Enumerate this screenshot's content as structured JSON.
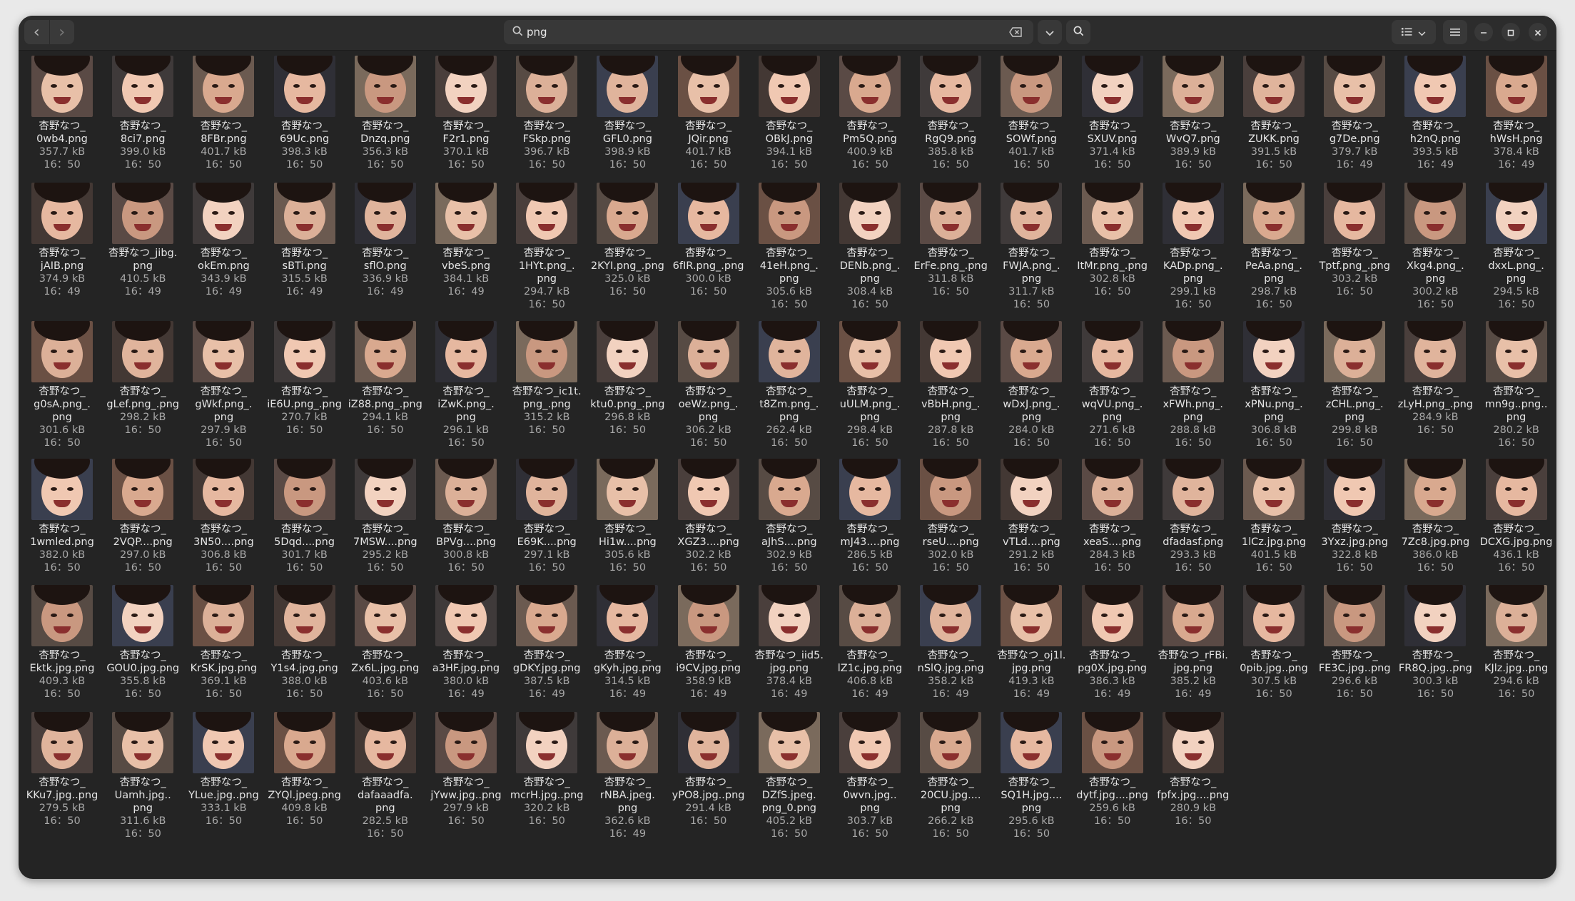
{
  "window": {
    "nav": {
      "back_icon": "chevron-left-icon",
      "forward_icon": "chevron-right-icon"
    },
    "search": {
      "value": "png",
      "placeholder": ""
    },
    "buttons": [
      "search-icon",
      "list-view-icon",
      "dropdown-icon",
      "menu-icon",
      "minimize-icon",
      "maximize-icon",
      "close-icon"
    ]
  },
  "rows": [
    [
      {
        "name": "杏野なつ_\n0wb4.png",
        "size": "357.7 kB",
        "time": "16：50"
      },
      {
        "name": "杏野なつ_\n8ci7.png",
        "size": "399.0 kB",
        "time": "16：50"
      },
      {
        "name": "杏野なつ_\n8FBr.png",
        "size": "401.7 kB",
        "time": "16：50"
      },
      {
        "name": "杏野なつ_\n69Uc.png",
        "size": "398.3 kB",
        "time": "16：50"
      },
      {
        "name": "杏野なつ_\nDnzq.png",
        "size": "356.3 kB",
        "time": "16：50"
      },
      {
        "name": "杏野なつ_\nF2r1.png",
        "size": "370.1 kB",
        "time": "16：50"
      },
      {
        "name": "杏野なつ_\nFSkp.png",
        "size": "396.7 kB",
        "time": "16：50"
      },
      {
        "name": "杏野なつ_\nGFL0.png",
        "size": "398.9 kB",
        "time": "16：50"
      },
      {
        "name": "杏野なつ_\nJQir.png",
        "size": "401.7 kB",
        "time": "16：50"
      },
      {
        "name": "杏野なつ_\nOBkJ.png",
        "size": "394.1 kB",
        "time": "16：50"
      },
      {
        "name": "杏野なつ_\nPm5Q.png",
        "size": "400.9 kB",
        "time": "16：50"
      },
      {
        "name": "杏野なつ_\nRgQ9.png",
        "size": "385.8 kB",
        "time": "16：50"
      },
      {
        "name": "杏野なつ_\nSOWf.png",
        "size": "401.7 kB",
        "time": "16：50"
      },
      {
        "name": "杏野なつ_\nSXUV.png",
        "size": "371.4 kB",
        "time": "16：50"
      },
      {
        "name": "杏野なつ_\nWvQ7.png",
        "size": "389.9 kB",
        "time": "16：50"
      },
      {
        "name": "杏野なつ_\nZUKK.png",
        "size": "391.5 kB",
        "time": "16：50"
      },
      {
        "name": "杏野なつ_\ng7De.png",
        "size": "379.7 kB",
        "time": "16：49"
      },
      {
        "name": "杏野なつ_\nh2nQ.png",
        "size": "393.5 kB",
        "time": "16：49"
      },
      {
        "name": "杏野なつ_\nhWsH.png",
        "size": "378.4 kB",
        "time": "16：49"
      }
    ],
    [
      {
        "name": "杏野なつ_\njAIB.png",
        "size": "374.9 kB",
        "time": "16：49"
      },
      {
        "name": "杏野なつ_jibg.\npng",
        "size": "410.5 kB",
        "time": "16：49"
      },
      {
        "name": "杏野なつ_\nokEm.png",
        "size": "343.9 kB",
        "time": "16：49"
      },
      {
        "name": "杏野なつ_\nsBTi.png",
        "size": "315.5 kB",
        "time": "16：49"
      },
      {
        "name": "杏野なつ_\nsflO.png",
        "size": "336.9 kB",
        "time": "16：49"
      },
      {
        "name": "杏野なつ_\nvbeS.png",
        "size": "384.1 kB",
        "time": "16：49"
      },
      {
        "name": "杏野なつ_\n1HYt.png_.\npng",
        "size": "294.7 kB",
        "time": "16：50"
      },
      {
        "name": "杏野なつ_\n2KYI.png_.png",
        "size": "325.0 kB",
        "time": "16：50"
      },
      {
        "name": "杏野なつ_\n6fIR.png_.png",
        "size": "300.0 kB",
        "time": "16：50"
      },
      {
        "name": "杏野なつ_\n41eH.png_.\npng",
        "size": "305.6 kB",
        "time": "16：50"
      },
      {
        "name": "杏野なつ_\nDENb.png_.\npng",
        "size": "308.4 kB",
        "time": "16：50"
      },
      {
        "name": "杏野なつ_\nErFe.png_.png",
        "size": "311.8 kB",
        "time": "16：50"
      },
      {
        "name": "杏野なつ_\nFWJA.png_.\npng",
        "size": "311.7 kB",
        "time": "16：50"
      },
      {
        "name": "杏野なつ_\nItMr.png_.png",
        "size": "302.8 kB",
        "time": "16：50"
      },
      {
        "name": "杏野なつ_\nKADp.png_.\npng",
        "size": "299.1 kB",
        "time": "16：50"
      },
      {
        "name": "杏野なつ_\nPeAa.png_.\npng",
        "size": "298.7 kB",
        "time": "16：50"
      },
      {
        "name": "杏野なつ_\nTptf.png_.png",
        "size": "303.2 kB",
        "time": "16：50"
      },
      {
        "name": "杏野なつ_\nXkg4.png_.\npng",
        "size": "300.2 kB",
        "time": "16：50"
      },
      {
        "name": "杏野なつ_\ndxxL.png_.\npng",
        "size": "294.5 kB",
        "time": "16：50"
      }
    ],
    [
      {
        "name": "杏野なつ_\ng0sA.png_.\npng",
        "size": "301.6 kB",
        "time": "16：50"
      },
      {
        "name": "杏野なつ_\ngLef.png_.png",
        "size": "298.2 kB",
        "time": "16：50"
      },
      {
        "name": "杏野なつ_\ngWkf.png_.\npng",
        "size": "297.9 kB",
        "time": "16：50"
      },
      {
        "name": "杏野なつ_\niE6U.png_.png",
        "size": "270.7 kB",
        "time": "16：50"
      },
      {
        "name": "杏野なつ_\niZ88.png_.png",
        "size": "294.1 kB",
        "time": "16：50"
      },
      {
        "name": "杏野なつ_\niZwK.png_.\npng",
        "size": "296.1 kB",
        "time": "16：50"
      },
      {
        "name": "杏野なつ_ic1t.\npng_.png",
        "size": "315.2 kB",
        "time": "16：50"
      },
      {
        "name": "杏野なつ_\nktu0.png_.png",
        "size": "296.8 kB",
        "time": "16：50"
      },
      {
        "name": "杏野なつ_\noeWz.png_.\npng",
        "size": "306.2 kB",
        "time": "16：50"
      },
      {
        "name": "杏野なつ_\nt8Zm.png_.\npng",
        "size": "262.4 kB",
        "time": "16：50"
      },
      {
        "name": "杏野なつ_\nuULM.png_.\npng",
        "size": "298.4 kB",
        "time": "16：50"
      },
      {
        "name": "杏野なつ_\nvBbH.png_.\npng",
        "size": "287.8 kB",
        "time": "16：50"
      },
      {
        "name": "杏野なつ_\nwDxJ.png_.\npng",
        "size": "284.0 kB",
        "time": "16：50"
      },
      {
        "name": "杏野なつ_\nwqVU.png_.\npng",
        "size": "271.6 kB",
        "time": "16：50"
      },
      {
        "name": "杏野なつ_\nxFWh.png_.\npng",
        "size": "288.8 kB",
        "time": "16：50"
      },
      {
        "name": "杏野なつ_\nxPNu.png_.\npng",
        "size": "306.8 kB",
        "time": "16：50"
      },
      {
        "name": "杏野なつ_\nzCHL.png_.\npng",
        "size": "299.8 kB",
        "time": "16：50"
      },
      {
        "name": "杏野なつ_\nzLyH.png_.png",
        "size": "284.9 kB",
        "time": "16：50"
      },
      {
        "name": "杏野なつ_\nmn9g..png..\npng",
        "size": "280.2 kB",
        "time": "16：50"
      }
    ],
    [
      {
        "name": "杏野なつ_\n1wmled.png",
        "size": "382.0 kB",
        "time": "16：50"
      },
      {
        "name": "杏野なつ_\n2VQP....png",
        "size": "297.0 kB",
        "time": "16：50"
      },
      {
        "name": "杏野なつ_\n3N50....png",
        "size": "306.8 kB",
        "time": "16：50"
      },
      {
        "name": "杏野なつ_\n5Dqd....png",
        "size": "301.7 kB",
        "time": "16：50"
      },
      {
        "name": "杏野なつ_\n7MSW....png",
        "size": "295.2 kB",
        "time": "16：50"
      },
      {
        "name": "杏野なつ_\nBPVg....png",
        "size": "300.8 kB",
        "time": "16：50"
      },
      {
        "name": "杏野なつ_\nE69K....png",
        "size": "297.1 kB",
        "time": "16：50"
      },
      {
        "name": "杏野なつ_\nHi1w....png",
        "size": "305.6 kB",
        "time": "16：50"
      },
      {
        "name": "杏野なつ_\nXGZ3....png",
        "size": "302.2 kB",
        "time": "16：50"
      },
      {
        "name": "杏野なつ_\naJhS....png",
        "size": "302.9 kB",
        "time": "16：50"
      },
      {
        "name": "杏野なつ_\nmJ43....png",
        "size": "286.5 kB",
        "time": "16：50"
      },
      {
        "name": "杏野なつ_\nrseU....png",
        "size": "302.0 kB",
        "time": "16：50"
      },
      {
        "name": "杏野なつ_\nvTLd....png",
        "size": "291.2 kB",
        "time": "16：50"
      },
      {
        "name": "杏野なつ_\nxeaS....png",
        "size": "284.3 kB",
        "time": "16：50"
      },
      {
        "name": "杏野なつ_\ndfadasf.png",
        "size": "293.3 kB",
        "time": "16：50"
      },
      {
        "name": "杏野なつ_\n1lCz.jpg.png",
        "size": "401.5 kB",
        "time": "16：50"
      },
      {
        "name": "杏野なつ_\n3Yxz.jpg.png",
        "size": "322.8 kB",
        "time": "16：50"
      },
      {
        "name": "杏野なつ_\n7Zc8.jpg.png",
        "size": "386.0 kB",
        "time": "16：50"
      },
      {
        "name": "杏野なつ_\nDCXG.jpg.png",
        "size": "436.1 kB",
        "time": "16：50"
      }
    ],
    [
      {
        "name": "杏野なつ_\nEktk.jpg.png",
        "size": "409.3 kB",
        "time": "16：50"
      },
      {
        "name": "杏野なつ_\nGOU0.jpg.png",
        "size": "355.8 kB",
        "time": "16：50"
      },
      {
        "name": "杏野なつ_\nKrSK.jpg.png",
        "size": "369.1 kB",
        "time": "16：50"
      },
      {
        "name": "杏野なつ_\nY1s4.jpg.png",
        "size": "388.0 kB",
        "time": "16：50"
      },
      {
        "name": "杏野なつ_\nZx6L.jpg.png",
        "size": "403.6 kB",
        "time": "16：50"
      },
      {
        "name": "杏野なつ_\na3HF.jpg.png",
        "size": "380.0 kB",
        "time": "16：49"
      },
      {
        "name": "杏野なつ_\ngDKY.jpg.png",
        "size": "387.5 kB",
        "time": "16：49"
      },
      {
        "name": "杏野なつ_\ngKyh.jpg.png",
        "size": "314.5 kB",
        "time": "16：49"
      },
      {
        "name": "杏野なつ_\ni9CV.jpg.png",
        "size": "358.9 kB",
        "time": "16：49"
      },
      {
        "name": "杏野なつ_iid5.\njpg.png",
        "size": "378.4 kB",
        "time": "16：49"
      },
      {
        "name": "杏野なつ_\nlZ1c.jpg.png",
        "size": "406.8 kB",
        "time": "16：49"
      },
      {
        "name": "杏野なつ_\nnSlQ.jpg.png",
        "size": "358.2 kB",
        "time": "16：49"
      },
      {
        "name": "杏野なつ_oj1l.\njpg.png",
        "size": "419.3 kB",
        "time": "16：49"
      },
      {
        "name": "杏野なつ_\npg0X.jpg.png",
        "size": "386.3 kB",
        "time": "16：49"
      },
      {
        "name": "杏野なつ_rFBi.\njpg.png",
        "size": "385.2 kB",
        "time": "16：49"
      },
      {
        "name": "杏野なつ_\n0pib.jpg..png",
        "size": "307.5 kB",
        "time": "16：50"
      },
      {
        "name": "杏野なつ_\nFE3C.jpg..png",
        "size": "296.6 kB",
        "time": "16：50"
      },
      {
        "name": "杏野なつ_\nFR8Q.jpg..png",
        "size": "300.3 kB",
        "time": "16：50"
      },
      {
        "name": "杏野なつ_\nKJlz.jpg..png",
        "size": "294.6 kB",
        "time": "16：50"
      }
    ],
    [
      {
        "name": "杏野なつ_\nKKu7.jpg..png",
        "size": "279.5 kB",
        "time": "16：50"
      },
      {
        "name": "杏野なつ_\nUamh.jpg..\npng",
        "size": "311.6 kB",
        "time": "16：50"
      },
      {
        "name": "杏野なつ_\nYLue.jpg..png",
        "size": "333.1 kB",
        "time": "16：50"
      },
      {
        "name": "杏野なつ_\nZYQl.jpeg.png",
        "size": "409.8 kB",
        "time": "16：50"
      },
      {
        "name": "杏野なつ_\ndafaaadfa.\npng",
        "size": "282.5 kB",
        "time": "16：50"
      },
      {
        "name": "杏野なつ_\njYww.jpg..png",
        "size": "297.9 kB",
        "time": "16：50"
      },
      {
        "name": "杏野なつ_\nmcrH.jpg..png",
        "size": "320.2 kB",
        "time": "16：50"
      },
      {
        "name": "杏野なつ_\nrNBA.jpeg.\npng",
        "size": "362.6 kB",
        "time": "16：49"
      },
      {
        "name": "杏野なつ_\nyPO8.jpg..png",
        "size": "291.4 kB",
        "time": "16：50"
      },
      {
        "name": "杏野なつ_\nDZfS.jpeg.\npng_0.png",
        "size": "405.2 kB",
        "time": "16：50"
      },
      {
        "name": "杏野なつ_\n0wvn.jpg..\npng",
        "size": "303.7 kB",
        "time": "16：50"
      },
      {
        "name": "杏野なつ_\n20CU.jpg....\npng",
        "size": "266.2 kB",
        "time": "16：50"
      },
      {
        "name": "杏野なつ_\nSQ1H.jpg....\npng",
        "size": "295.6 kB",
        "time": "16：50"
      },
      {
        "name": "杏野なつ_\ndytf.jpg....png",
        "size": "259.6 kB",
        "time": "16：50"
      },
      {
        "name": "杏野なつ_\nfpfx.jpg....png",
        "size": "280.9 kB",
        "time": "16：50"
      }
    ]
  ]
}
